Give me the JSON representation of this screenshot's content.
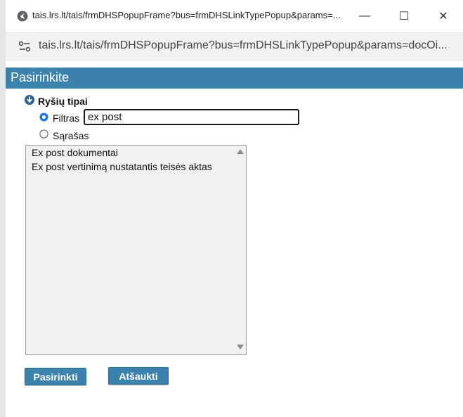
{
  "window": {
    "title": "tais.lrs.lt/tais/frmDHSPopupFrame?bus=frmDHSLinkTypePopup&params=...",
    "minimize_glyph": "—",
    "maximize_glyph": "☐",
    "close_glyph": "✕"
  },
  "address_bar": {
    "url": "tais.lrs.lt/tais/frmDHSPopupFrame?bus=frmDHSLinkTypePopup&params=docOi..."
  },
  "header": {
    "title": "Pasirinkite"
  },
  "section": {
    "label": "Ryšių tipai",
    "icon": "collapse-arrow-icon"
  },
  "radios": {
    "filtras": {
      "label": "Filtras",
      "checked": true
    },
    "sarasas": {
      "label": "Sąrašas",
      "checked": false
    }
  },
  "filter": {
    "value": "ex post"
  },
  "list": {
    "items": [
      "Ex post dokumentai",
      "Ex post vertinimą nustatantis teisės aktas"
    ]
  },
  "buttons": {
    "select_label": "Pasirinkti",
    "cancel_label": "Atšaukti"
  },
  "colors": {
    "accent": "#3b82ac",
    "radio_selected": "#1a73e8"
  }
}
